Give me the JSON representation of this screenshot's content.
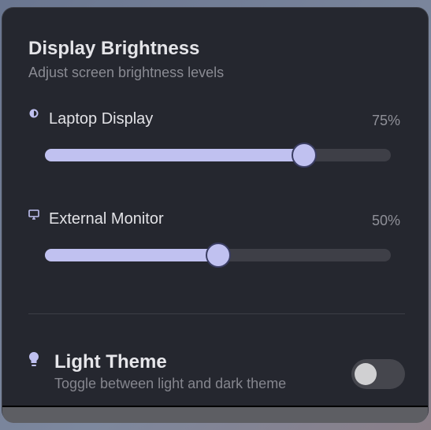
{
  "header": {
    "title": "Display Brightness",
    "subtitle": "Adjust screen brightness levels"
  },
  "sliders": [
    {
      "label": "Laptop Display",
      "value_text": "75%",
      "value": 75,
      "icon": "brightness-icon"
    },
    {
      "label": "External Monitor",
      "value_text": "50%",
      "value": 50,
      "icon": "monitor-icon"
    }
  ],
  "theme": {
    "title": "Light Theme",
    "subtitle": "Toggle between light and dark theme",
    "enabled": false,
    "icon": "lightbulb-icon"
  },
  "colors": {
    "accent": "#c0c1f0",
    "panel": "#25272f"
  }
}
